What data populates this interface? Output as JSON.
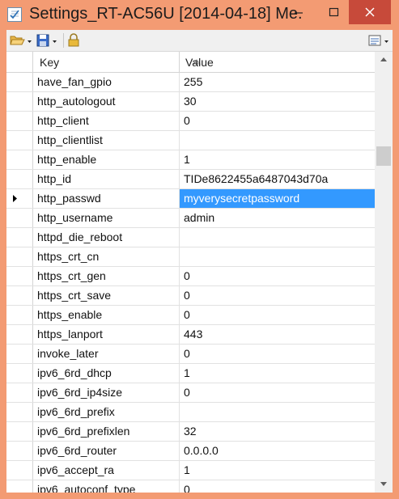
{
  "window": {
    "title": "Settings_RT-AC56U [2014-04-18] Me...",
    "accent_color": "#f39b73",
    "close_color": "#c74a3a"
  },
  "titlebar_buttons": [
    "minimize-icon",
    "maximize-icon",
    "close-icon"
  ],
  "toolbar": {
    "items": [
      "open-folder-icon",
      "dropdown-arrow-icon",
      "save-disk-icon",
      "dropdown-arrow-icon",
      "lock-icon",
      "view-options-icon"
    ]
  },
  "grid": {
    "columns": [
      "Key",
      "Value"
    ],
    "selected_row": 6,
    "selection_color": "#3399ff",
    "rows": [
      {
        "key": "have_fan_gpio",
        "value": "255"
      },
      {
        "key": "http_autologout",
        "value": "30"
      },
      {
        "key": "http_client",
        "value": "0"
      },
      {
        "key": "http_clientlist",
        "value": ""
      },
      {
        "key": "http_enable",
        "value": "1"
      },
      {
        "key": "http_id",
        "value": "TIDe8622455a6487043d70a"
      },
      {
        "key": "http_passwd",
        "value": "myverysecretpassword"
      },
      {
        "key": "http_username",
        "value": "admin"
      },
      {
        "key": "httpd_die_reboot",
        "value": ""
      },
      {
        "key": "https_crt_cn",
        "value": ""
      },
      {
        "key": "https_crt_gen",
        "value": "0"
      },
      {
        "key": "https_crt_save",
        "value": "0"
      },
      {
        "key": "https_enable",
        "value": "0"
      },
      {
        "key": "https_lanport",
        "value": "443"
      },
      {
        "key": "invoke_later",
        "value": "0"
      },
      {
        "key": "ipv6_6rd_dhcp",
        "value": "1"
      },
      {
        "key": "ipv6_6rd_ip4size",
        "value": "0"
      },
      {
        "key": "ipv6_6rd_prefix",
        "value": ""
      },
      {
        "key": "ipv6_6rd_prefixlen",
        "value": "32"
      },
      {
        "key": "ipv6_6rd_router",
        "value": "0.0.0.0"
      },
      {
        "key": "ipv6_accept_ra",
        "value": "1"
      },
      {
        "key": "ipv6_autoconf_type",
        "value": "0"
      }
    ]
  }
}
